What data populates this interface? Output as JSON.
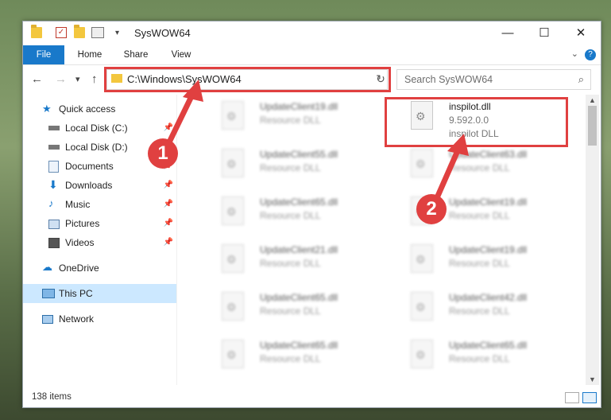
{
  "titlebar": {
    "title": "SysWOW64",
    "minimize": "—",
    "maximize": "☐",
    "close": "✕"
  },
  "ribbon": {
    "tabs": [
      "File",
      "Home",
      "Share",
      "View"
    ],
    "help": "?"
  },
  "nav": {
    "back": "←",
    "forward": "→",
    "recent": "▾",
    "up": "↑",
    "address": "C:\\Windows\\SysWOW64",
    "search_placeholder": "Search SysWOW64"
  },
  "sidebar": {
    "items": [
      {
        "label": "Quick access",
        "icon": "star-icon"
      },
      {
        "label": "Local Disk (C:)",
        "icon": "drive-icon"
      },
      {
        "label": "Local Disk (D:)",
        "icon": "drive-icon"
      },
      {
        "label": "Documents",
        "icon": "documents-icon"
      },
      {
        "label": "Downloads",
        "icon": "download-icon"
      },
      {
        "label": "Music",
        "icon": "music-icon"
      },
      {
        "label": "Pictures",
        "icon": "pictures-icon"
      },
      {
        "label": "Videos",
        "icon": "videos-icon"
      },
      {
        "label": "OneDrive",
        "icon": "cloud-icon"
      },
      {
        "label": "This PC",
        "icon": "computer-icon"
      },
      {
        "label": "Network",
        "icon": "network-icon"
      }
    ]
  },
  "files": {
    "left": [
      {
        "name": "UpdateClient19.dll",
        "desc": "Resource DLL"
      },
      {
        "name": "UpdateClient55.dll",
        "desc": "Resource DLL"
      },
      {
        "name": "UpdateClient65.dll",
        "desc": "Resource DLL"
      },
      {
        "name": "UpdateClient21.dll",
        "desc": "Resource DLL"
      },
      {
        "name": "UpdateClient65.dll",
        "desc": "Resource DLL"
      },
      {
        "name": "UpdateClient65.dll",
        "desc": "Resource DLL"
      }
    ],
    "right": [
      {
        "name": "inspilot.dll",
        "desc": "9.592.0.0",
        "extra": "inspilot DLL"
      },
      {
        "name": "UpdateClient63.dll",
        "desc": "Resource DLL"
      },
      {
        "name": "UpdateClient19.dll",
        "desc": "Resource DLL"
      },
      {
        "name": "UpdateClient19.dll",
        "desc": "Resource DLL"
      },
      {
        "name": "UpdateClient42.dll",
        "desc": "Resource DLL"
      },
      {
        "name": "UpdateClient65.dll",
        "desc": "Resource DLL"
      }
    ]
  },
  "status": {
    "count": "138 items"
  },
  "annotations": {
    "badge1": "1",
    "badge2": "2",
    "color": "#e04040"
  }
}
